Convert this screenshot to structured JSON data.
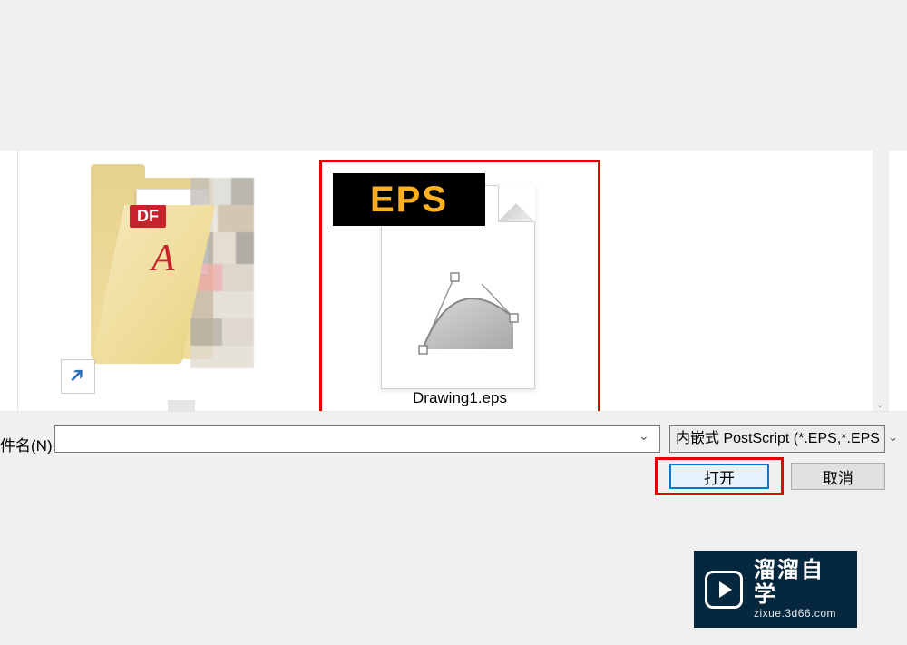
{
  "dialog": {
    "filename_label": "件名(N):",
    "filename_value": "",
    "filetype_selected": "内嵌式 PostScript (*.EPS,*.EPS",
    "open_label": "打开",
    "cancel_label": "取消"
  },
  "files": {
    "selected_file": {
      "name": "Drawing1.eps",
      "badge": "EPS"
    },
    "folder": {
      "pdf_badge": "DF"
    }
  },
  "watermark": {
    "main": "溜溜自学",
    "sub": "zixue.3d66.com"
  },
  "icons": {
    "shortcut_arrow": "↗",
    "dropdown_small": "⌄",
    "dropdown_filetype": "⌄",
    "scrollbar_down": "⌄"
  }
}
